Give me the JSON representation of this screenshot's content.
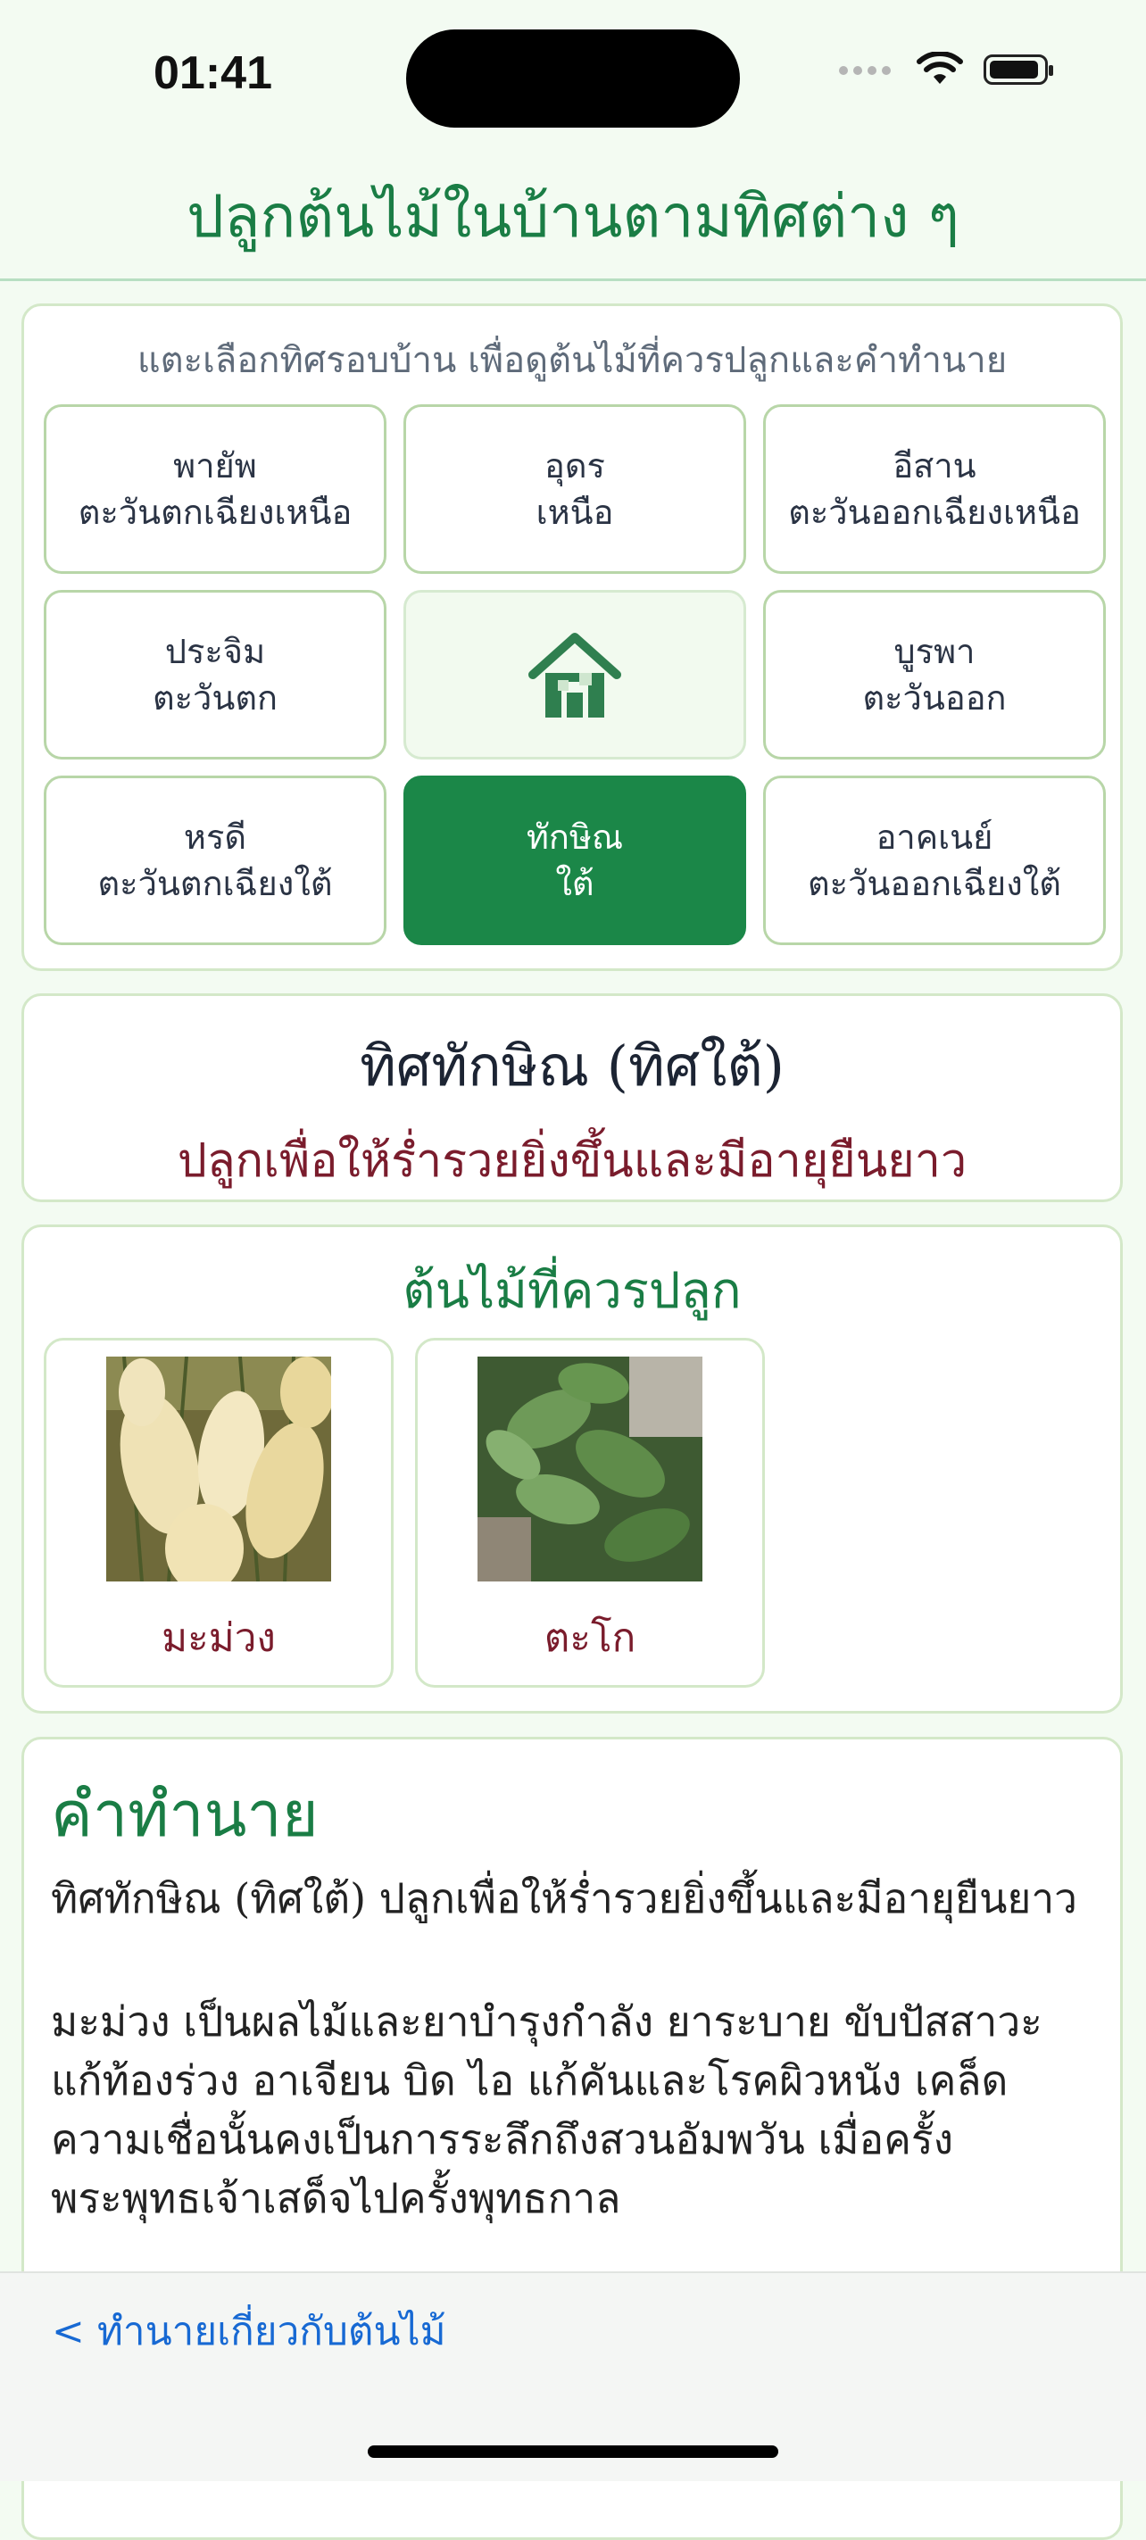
{
  "status_bar": {
    "time": "01:41"
  },
  "header": {
    "title": "ปลูกต้นไม้ในบ้านตามทิศต่าง ๆ"
  },
  "compass": {
    "hint": "แตะเลือกทิศรอบบ้าน เพื่อดูต้นไม้ที่ควรปลูกและคำทำนาย",
    "directions": [
      {
        "name": "พายัพ",
        "sub": "ตะวันตกเฉียงเหนือ"
      },
      {
        "name": "อุดร",
        "sub": "เหนือ"
      },
      {
        "name": "อีสาน",
        "sub": "ตะวันออกเฉียงเหนือ"
      },
      {
        "name": "ประจิม",
        "sub": "ตะวันตก"
      },
      {
        "name": "",
        "sub": ""
      },
      {
        "name": "บูรพา",
        "sub": "ตะวันออก"
      },
      {
        "name": "หรดี",
        "sub": "ตะวันตกเฉียงใต้"
      },
      {
        "name": "ทักษิณ",
        "sub": "ใต้"
      },
      {
        "name": "อาคเนย์",
        "sub": "ตะวันออกเฉียงใต้"
      }
    ],
    "center_icon": "house-icon",
    "selected": "ทักษิณ"
  },
  "selected_direction": {
    "title": "ทิศทักษิณ (ทิศใต้)",
    "subtitle": "ปลูกเพื่อให้ร่ำรวยยิ่งขึ้นและมีอายุยืนยาว"
  },
  "plants": {
    "title": "ต้นไม้ที่ควรปลูก",
    "items": [
      {
        "name": "มะม่วง",
        "image": "mango-photo"
      },
      {
        "name": "ตะโก",
        "image": "tako-leaves-photo"
      }
    ]
  },
  "prediction": {
    "title": "คำทำนาย",
    "paragraph1": "ทิศทักษิณ (ทิศใต้) ปลูกเพื่อให้ร่ำรวยยิ่งขึ้นและมีอายุยืนยาว",
    "paragraph2": "มะม่วง เป็นผลไม้และยาบำรุงกำลัง ยาระบาย ขับปัสสาวะ แก้ท้องร่วง อาเจียน บิด ไอ แก้คันและโรคผิวหนัง เคล็ดความเชื่อนั้นคงเป็นการระลึกถึงสวนอัมพวัน เมื่อครั้งพระพุทธเจ้าเสด็จไปครั้งพุทธกาล"
  },
  "bottom_bar": {
    "back_label": "< ทำนายเกี่ยวกับต้นไม้"
  },
  "colors": {
    "accent": "#1b8748",
    "maroon": "#7a1c2c",
    "link": "#1769d3"
  }
}
